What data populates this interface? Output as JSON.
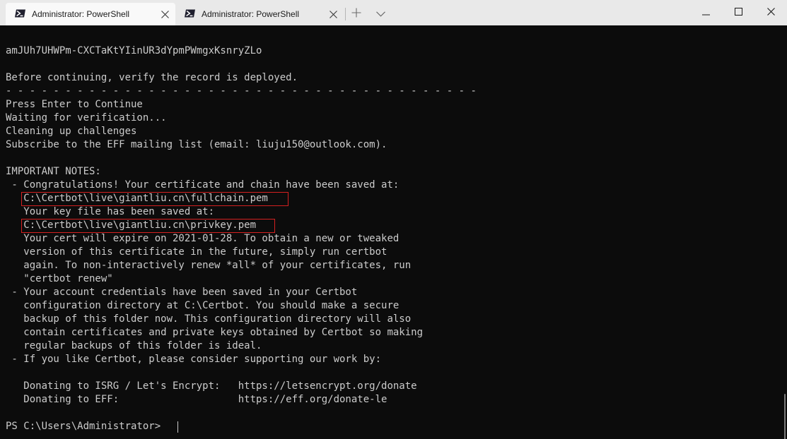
{
  "tabs": [
    {
      "label": "Administrator: PowerShell",
      "active": true,
      "icon": "powershell-icon"
    },
    {
      "label": "Administrator: PowerShell",
      "active": false,
      "icon": "powershell-icon"
    }
  ],
  "titlebar": {
    "new_tab_icon": "plus-icon",
    "dropdown_icon": "chevron-down-icon",
    "minimize_icon": "minimize-icon",
    "maximize_icon": "maximize-icon",
    "close_icon": "close-icon"
  },
  "terminal": {
    "lines": [
      "amJUh7UHWPm-CXCTaKtYIinUR3dYpmPWmgxKsnryZLo",
      "",
      "Before continuing, verify the record is deployed.",
      "- - - - - - - - - - - - - - - - - - - - - - - - - - - - - - - - - - - - - - - -",
      "Press Enter to Continue",
      "Waiting for verification...",
      "Cleaning up challenges",
      "Subscribe to the EFF mailing list (email: liuju150@outlook.com).",
      "",
      "IMPORTANT NOTES:",
      " - Congratulations! Your certificate and chain have been saved at:",
      "   C:\\Certbot\\live\\giantliu.cn\\fullchain.pem",
      "   Your key file has been saved at:",
      "   C:\\Certbot\\live\\giantliu.cn\\privkey.pem",
      "   Your cert will expire on 2021-01-28. To obtain a new or tweaked",
      "   version of this certificate in the future, simply run certbot",
      "   again. To non-interactively renew *all* of your certificates, run",
      "   \"certbot renew\"",
      " - Your account credentials have been saved in your Certbot",
      "   configuration directory at C:\\Certbot. You should make a secure",
      "   backup of this folder now. This configuration directory will also",
      "   contain certificates and private keys obtained by Certbot so making",
      "   regular backups of this folder is ideal.",
      " - If you like Certbot, please consider supporting our work by:",
      "",
      "   Donating to ISRG / Let's Encrypt:   https://letsencrypt.org/donate",
      "   Donating to EFF:                    https://eff.org/donate-le",
      "",
      "PS C:\\Users\\Administrator> "
    ],
    "highlight_color": "#d42020",
    "text_color": "#cccccc",
    "background": "#0c0c0c"
  }
}
